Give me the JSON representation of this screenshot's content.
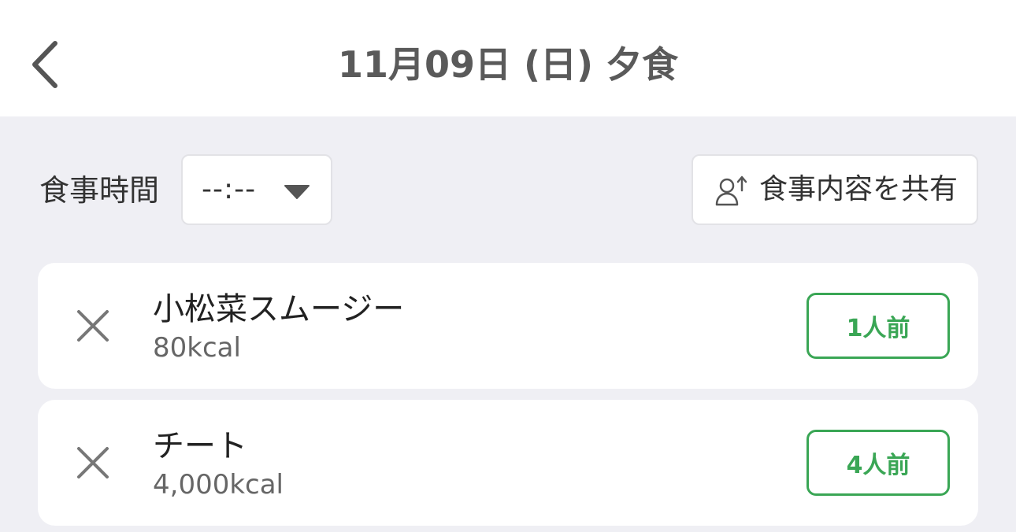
{
  "header": {
    "title": "11月09日 (日) 夕食",
    "back_icon": "chevron-left-icon"
  },
  "meal_time": {
    "label": "食事時間",
    "value": "--:--",
    "caret_icon": "caret-down-icon"
  },
  "share": {
    "label": "食事内容を共有",
    "icon": "person-share-icon"
  },
  "colors": {
    "background": "#efeff4",
    "accent_green": "#3aa655",
    "text_primary": "#222222",
    "text_secondary": "#666666"
  },
  "foods": [
    {
      "name": "小松菜スムージー",
      "kcal": "80kcal",
      "serving": "1人前",
      "remove_icon": "close-icon"
    },
    {
      "name": "チート",
      "kcal": "4,000kcal",
      "serving": "4人前",
      "remove_icon": "close-icon"
    }
  ]
}
